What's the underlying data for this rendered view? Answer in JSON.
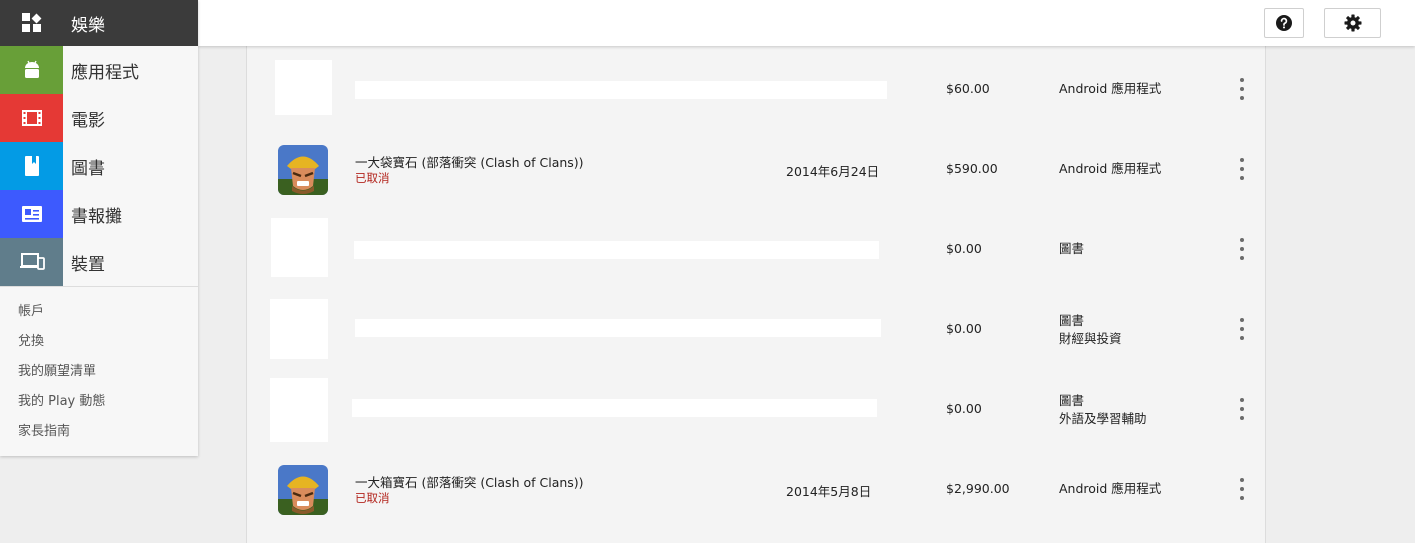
{
  "sidebar": {
    "top": {
      "label": "娛樂",
      "icon": "grid-icon",
      "bg": "#3b3b3b"
    },
    "items": [
      {
        "label": "應用程式",
        "icon": "android-icon",
        "color": "#689f38"
      },
      {
        "label": "電影",
        "icon": "film-icon",
        "color": "#e53935"
      },
      {
        "label": "圖書",
        "icon": "book-icon",
        "color": "#039be5"
      },
      {
        "label": "書報攤",
        "icon": "newsstand-icon",
        "color": "#3d5afe"
      },
      {
        "label": "裝置",
        "icon": "devices-icon",
        "color": "#607d8b"
      }
    ],
    "links": [
      "帳戶",
      "兌換",
      "我的願望清單",
      "我的 Play 動態",
      "家長指南"
    ]
  },
  "header": {
    "help_icon": "help-icon",
    "settings_icon": "gear-icon"
  },
  "orders": [
    {
      "title": "",
      "status": "",
      "date": "",
      "price": "$60.00",
      "category": [
        "Android 應用程式"
      ]
    },
    {
      "title": "一大袋寶石 (部落衝突 (Clash of Clans))",
      "status": "已取消",
      "date": "2014年6月24日",
      "price": "$590.00",
      "category": [
        "Android 應用程式"
      ]
    },
    {
      "title": "",
      "status": "",
      "date": "",
      "price": "$0.00",
      "category": [
        "圖書"
      ]
    },
    {
      "title": "",
      "status": "",
      "date": "",
      "price": "$0.00",
      "category": [
        "圖書",
        "財經與投資"
      ]
    },
    {
      "title": "",
      "status": "",
      "date": "",
      "price": "$0.00",
      "category": [
        "圖書",
        "外語及學習輔助"
      ]
    },
    {
      "title": "一大箱寶石 (部落衝突 (Clash of Clans))",
      "status": "已取消",
      "date": "2014年5月8日",
      "price": "$2,990.00",
      "category": [
        "Android 應用程式"
      ]
    }
  ]
}
